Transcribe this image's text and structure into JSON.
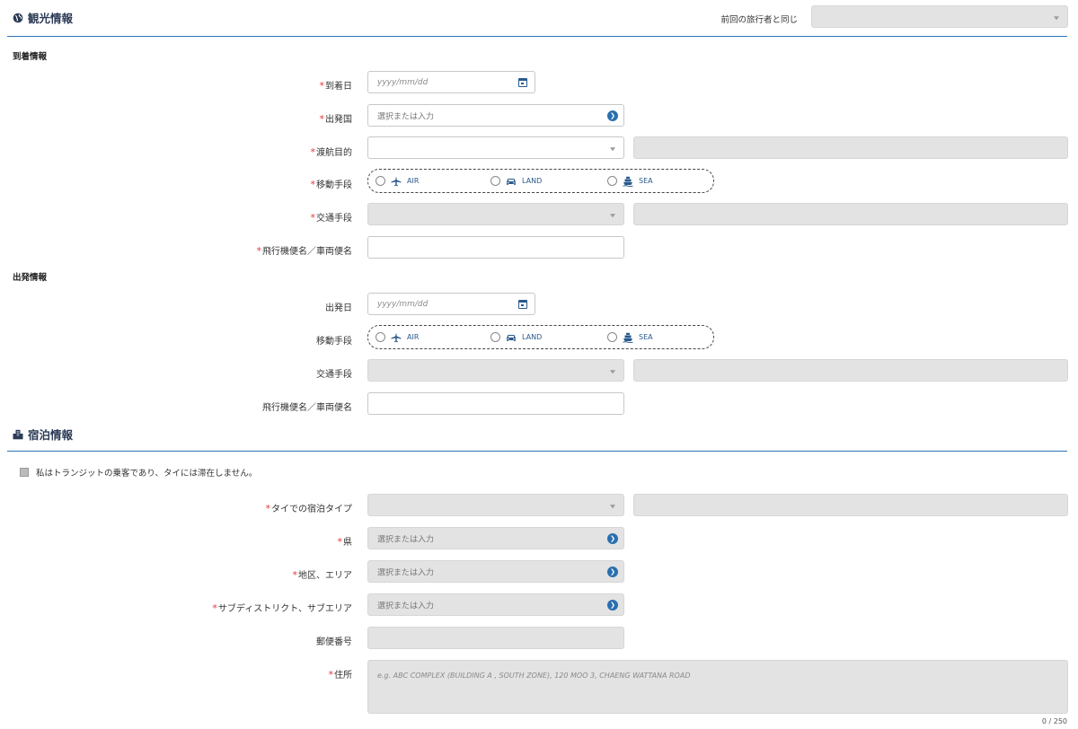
{
  "sightseeing": {
    "title": "観光情報",
    "same_as_previous_label": "前回の旅行者と同じ",
    "same_as_previous_value": ""
  },
  "arrival": {
    "title": "到着情報",
    "arrival_date": {
      "label": "到着日",
      "placeholder": "yyyy/mm/dd",
      "required": true
    },
    "departure_country": {
      "label": "出発国",
      "placeholder": "選択または入力",
      "required": true
    },
    "purpose": {
      "label": "渡航目的",
      "value": "",
      "other": "",
      "required": true
    },
    "travel_mode": {
      "label": "移動手段",
      "required": true,
      "options": [
        "AIR",
        "LAND",
        "SEA"
      ]
    },
    "transport": {
      "label": "交通手段",
      "value": "",
      "other": "",
      "required": true
    },
    "flight_no": {
      "label": "飛行機便名／車両便名",
      "value": "",
      "required": true
    }
  },
  "departure": {
    "title": "出発情報",
    "departure_date": {
      "label": "出発日",
      "placeholder": "yyyy/mm/dd"
    },
    "travel_mode": {
      "label": "移動手段",
      "options": [
        "AIR",
        "LAND",
        "SEA"
      ]
    },
    "transport": {
      "label": "交通手段",
      "value": "",
      "other": ""
    },
    "flight_no": {
      "label": "飛行機便名／車両便名",
      "value": ""
    }
  },
  "accommodation": {
    "title": "宿泊情報",
    "transit_checkbox_label": "私はトランジットの乗客であり、タイには滞在しません。",
    "stay_type": {
      "label": "タイでの宿泊タイプ",
      "value": "",
      "other": "",
      "required": true
    },
    "province": {
      "label": "県",
      "placeholder": "選択または入力",
      "required": true
    },
    "district": {
      "label": "地区、エリア",
      "placeholder": "選択または入力",
      "required": true
    },
    "subdistrict": {
      "label": "サブディストリクト、サブエリア",
      "placeholder": "選択または入力",
      "required": true
    },
    "postal_code": {
      "label": "郵便番号",
      "value": ""
    },
    "address": {
      "label": "住所",
      "placeholder": "e.g. ABC COMPLEX (BUILDING A , SOUTH ZONE), 120 MOO 3, CHAENG WATTANA ROAD",
      "required": true,
      "counter": "0 / 250"
    }
  },
  "required_mark": "*",
  "colors": {
    "accent": "#2a73b8",
    "required": "#e53935",
    "disabled_bg": "#e3e3e3"
  },
  "icons": {
    "sightseeing": "globe-icon",
    "accommodation": "building-icon",
    "air": "airplane-icon",
    "land": "car-icon",
    "sea": "ship-icon",
    "calendar": "calendar-icon"
  }
}
